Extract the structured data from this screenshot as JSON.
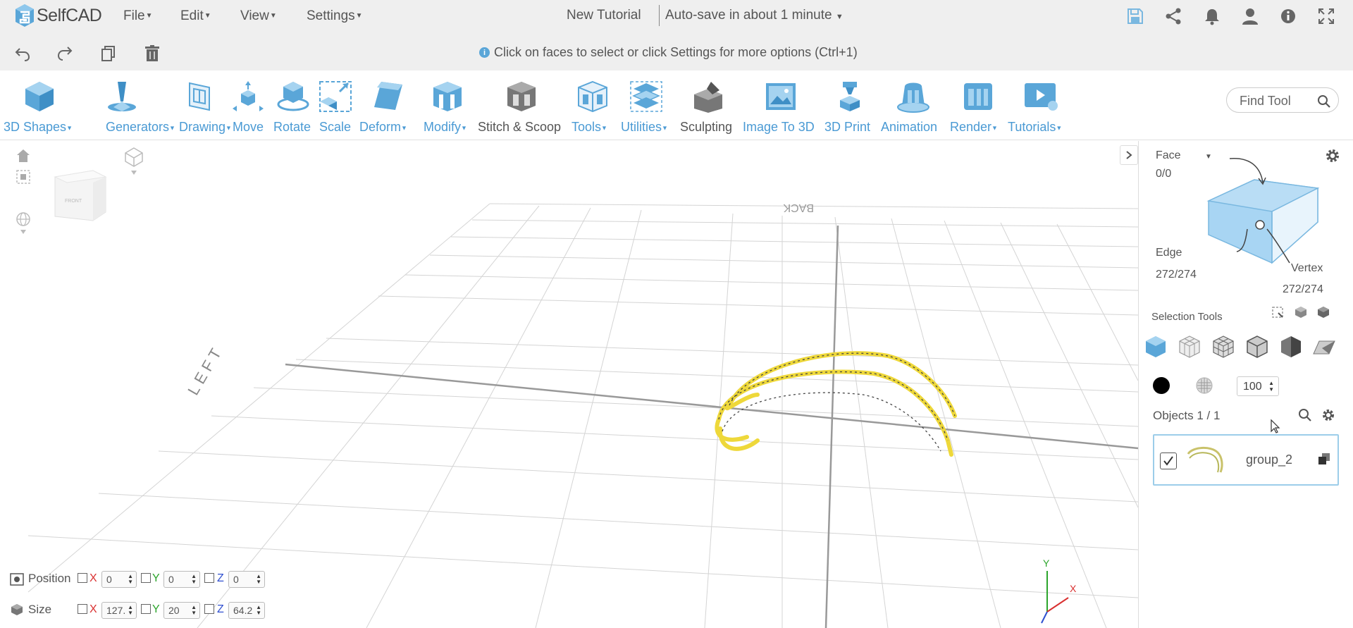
{
  "app": {
    "name": "SelfCAD",
    "menus": [
      "File",
      "Edit",
      "View",
      "Settings"
    ],
    "document_title": "New Tutorial",
    "autosave": "Auto-save in about 1 minute"
  },
  "hint": "Click on faces to select or click Settings for more options (Ctrl+1)",
  "tools": [
    {
      "label": "3D Shapes",
      "dropdown": true
    },
    {
      "label": "Generators",
      "dropdown": true
    },
    {
      "label": "Drawing",
      "dropdown": true
    },
    {
      "label": "Move",
      "dropdown": false
    },
    {
      "label": "Rotate",
      "dropdown": false
    },
    {
      "label": "Scale",
      "dropdown": false
    },
    {
      "label": "Deform",
      "dropdown": true
    },
    {
      "label": "Modify",
      "dropdown": true
    },
    {
      "label": "Stitch & Scoop",
      "dropdown": false
    },
    {
      "label": "Tools",
      "dropdown": true
    },
    {
      "label": "Utilities",
      "dropdown": true
    },
    {
      "label": "Sculpting",
      "dropdown": false
    },
    {
      "label": "Image To 3D",
      "dropdown": false
    },
    {
      "label": "3D Print",
      "dropdown": false
    },
    {
      "label": "Animation",
      "dropdown": false
    },
    {
      "label": "Render",
      "dropdown": true
    },
    {
      "label": "Tutorials",
      "dropdown": true
    }
  ],
  "find_tool_placeholder": "Find Tool",
  "viewcube": {
    "face_label": "FRONT"
  },
  "grid_labels": {
    "back": "BACK",
    "left": "LEFT"
  },
  "selection": {
    "mode": "Face",
    "face_count": "0/0",
    "edge_label": "Edge",
    "edge_count": "272/274",
    "vertex_label": "Vertex",
    "vertex_count": "272/274",
    "tools_label": "Selection Tools",
    "opacity_value": "100"
  },
  "objects": {
    "header": "Objects 1 / 1",
    "items": [
      {
        "name": "group_2",
        "checked": true
      }
    ]
  },
  "transform": {
    "position_label": "Position",
    "size_label": "Size",
    "position": {
      "x": "0",
      "y": "0",
      "z": "0"
    },
    "size": {
      "x": "127.",
      "y": "20",
      "z": "64.2"
    }
  },
  "axis_gizmo": {
    "x": "X",
    "y": "Y"
  },
  "colors": {
    "accent": "#4a9ad4",
    "object_yellow": "#f0dc3a",
    "panel_bg": "#efefef"
  }
}
